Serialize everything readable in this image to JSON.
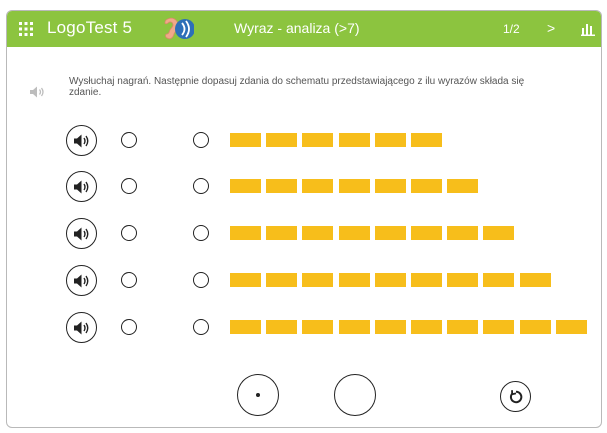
{
  "header": {
    "app_title": "LogoTest 5",
    "exercise_title": "Wyraz - analiza (>7)",
    "pager": "1/2",
    "next_label": ">",
    "icons": [
      "menu-grid-icon",
      "ear-sound-icon",
      "stats-bars-icon"
    ]
  },
  "instruction": {
    "text": "Wysłuchaj nagrań. Następnie dopasuj zdania do schematu przedstawiającego z ilu wyrazów składa się zdanie.",
    "icon": "speaker-icon"
  },
  "rows": [
    {
      "word_count": 6
    },
    {
      "word_count": 7
    },
    {
      "word_count": 8
    },
    {
      "word_count": 9
    },
    {
      "word_count": 10
    }
  ],
  "controls": {
    "icons": [
      "dot-point-icon",
      "empty-circle-icon",
      "reset-icon"
    ]
  },
  "colors": {
    "header_bg": "#8cc43f",
    "word_block": "#f7be1b",
    "outline": "#222222"
  }
}
